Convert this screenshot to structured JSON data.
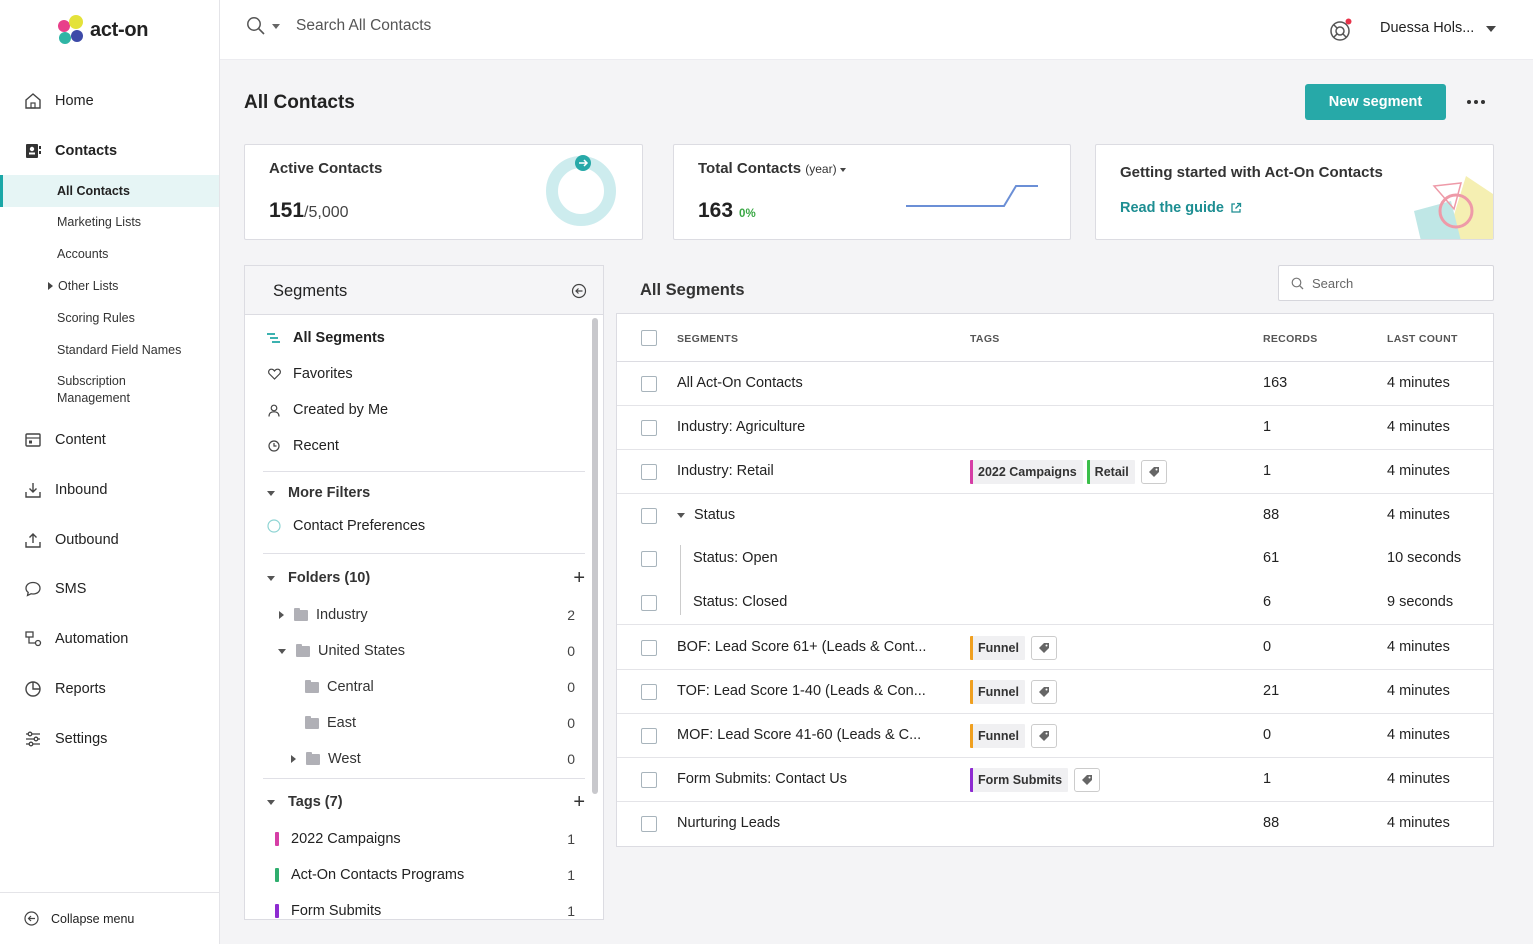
{
  "brand": {
    "name": "act-on"
  },
  "sidebar": {
    "nav": [
      {
        "label": "Home",
        "icon": "home-icon"
      },
      {
        "label": "Contacts",
        "icon": "contacts-icon"
      },
      {
        "label": "Content",
        "icon": "content-icon"
      },
      {
        "label": "Inbound",
        "icon": "inbound-icon"
      },
      {
        "label": "Outbound",
        "icon": "outbound-icon"
      },
      {
        "label": "SMS",
        "icon": "sms-icon"
      },
      {
        "label": "Automation",
        "icon": "automation-icon"
      },
      {
        "label": "Reports",
        "icon": "reports-icon"
      },
      {
        "label": "Settings",
        "icon": "settings-icon"
      }
    ],
    "sub": [
      "All Contacts",
      "Marketing Lists",
      "Accounts",
      "Other Lists",
      "Scoring Rules",
      "Standard Field Names",
      "Subscription Management"
    ],
    "collapse": "Collapse menu"
  },
  "topbar": {
    "search_placeholder": "Search All Contacts",
    "user": "Duessa Hols..."
  },
  "page": {
    "title": "All Contacts",
    "new_segment": "New segment"
  },
  "cards": {
    "active": {
      "title": "Active Contacts",
      "value": "151",
      "limit": "/5,000"
    },
    "total": {
      "title": "Total Contacts",
      "period": "(year)",
      "value": "163",
      "change": "0%"
    },
    "guide": {
      "title": "Getting started with Act-On Contacts",
      "link": "Read the guide"
    }
  },
  "segments_panel": {
    "title": "Segments",
    "filters": [
      "All Segments",
      "Favorites",
      "Created by Me",
      "Recent"
    ],
    "more_filters": "More Filters",
    "contact_prefs": "Contact Preferences",
    "folders_title": "Folders (10)",
    "folders": [
      {
        "name": "Industry",
        "count": "2"
      },
      {
        "name": "United States",
        "count": "0"
      },
      {
        "name": "Central",
        "count": "0"
      },
      {
        "name": "East",
        "count": "0"
      },
      {
        "name": "West",
        "count": "0"
      }
    ],
    "tags_title": "Tags (7)",
    "tags": [
      {
        "name": "2022 Campaigns",
        "count": "1",
        "color": "#d63ea6"
      },
      {
        "name": "Act-On Contacts Programs",
        "count": "1",
        "color": "#2fae6e"
      },
      {
        "name": "Form Submits",
        "count": "1",
        "color": "#8e2bd1"
      }
    ]
  },
  "table": {
    "title": "All Segments",
    "search_placeholder": "Search",
    "headers": {
      "segments": "SEGMENTS",
      "tags": "TAGS",
      "records": "RECORDS",
      "last_count": "LAST COUNT"
    },
    "rows": [
      {
        "name": "All Act-On Contacts",
        "records": "163",
        "last": "4 minutes"
      },
      {
        "name": "Industry: Agriculture",
        "records": "1",
        "last": "4 minutes"
      },
      {
        "name": "Industry:  Retail",
        "records": "1",
        "last": "4 minutes",
        "tags": [
          "2022 Campaigns",
          "Retail"
        ]
      },
      {
        "name": "Status",
        "records": "88",
        "last": "4 minutes"
      },
      {
        "name": "Status:  Open",
        "records": "61",
        "last": "10 seconds"
      },
      {
        "name": "Status:  Closed",
        "records": "6",
        "last": "9 seconds"
      },
      {
        "name": "BOF:  Lead Score 61+ (Leads & Cont...",
        "records": "0",
        "last": "4 minutes",
        "tags": [
          "Funnel"
        ]
      },
      {
        "name": "TOF:  Lead Score 1-40 (Leads & Con...",
        "records": "21",
        "last": "4 minutes",
        "tags": [
          "Funnel"
        ]
      },
      {
        "name": "MOF:  Lead Score 41-60 (Leads & C...",
        "records": "0",
        "last": "4 minutes",
        "tags": [
          "Funnel"
        ]
      },
      {
        "name": "Form Submits: Contact Us",
        "records": "1",
        "last": "4 minutes",
        "tags": [
          "Form Submits"
        ]
      },
      {
        "name": "Nurturing Leads",
        "records": "88",
        "last": "4 minutes"
      }
    ]
  },
  "colors": {
    "accent": "#27a9a8",
    "campaigns": "#d63ea6",
    "retail": "#3bbf4a",
    "funnel": "#f0a020",
    "form_submits": "#8e2bd1",
    "positive": "#3aa845"
  }
}
